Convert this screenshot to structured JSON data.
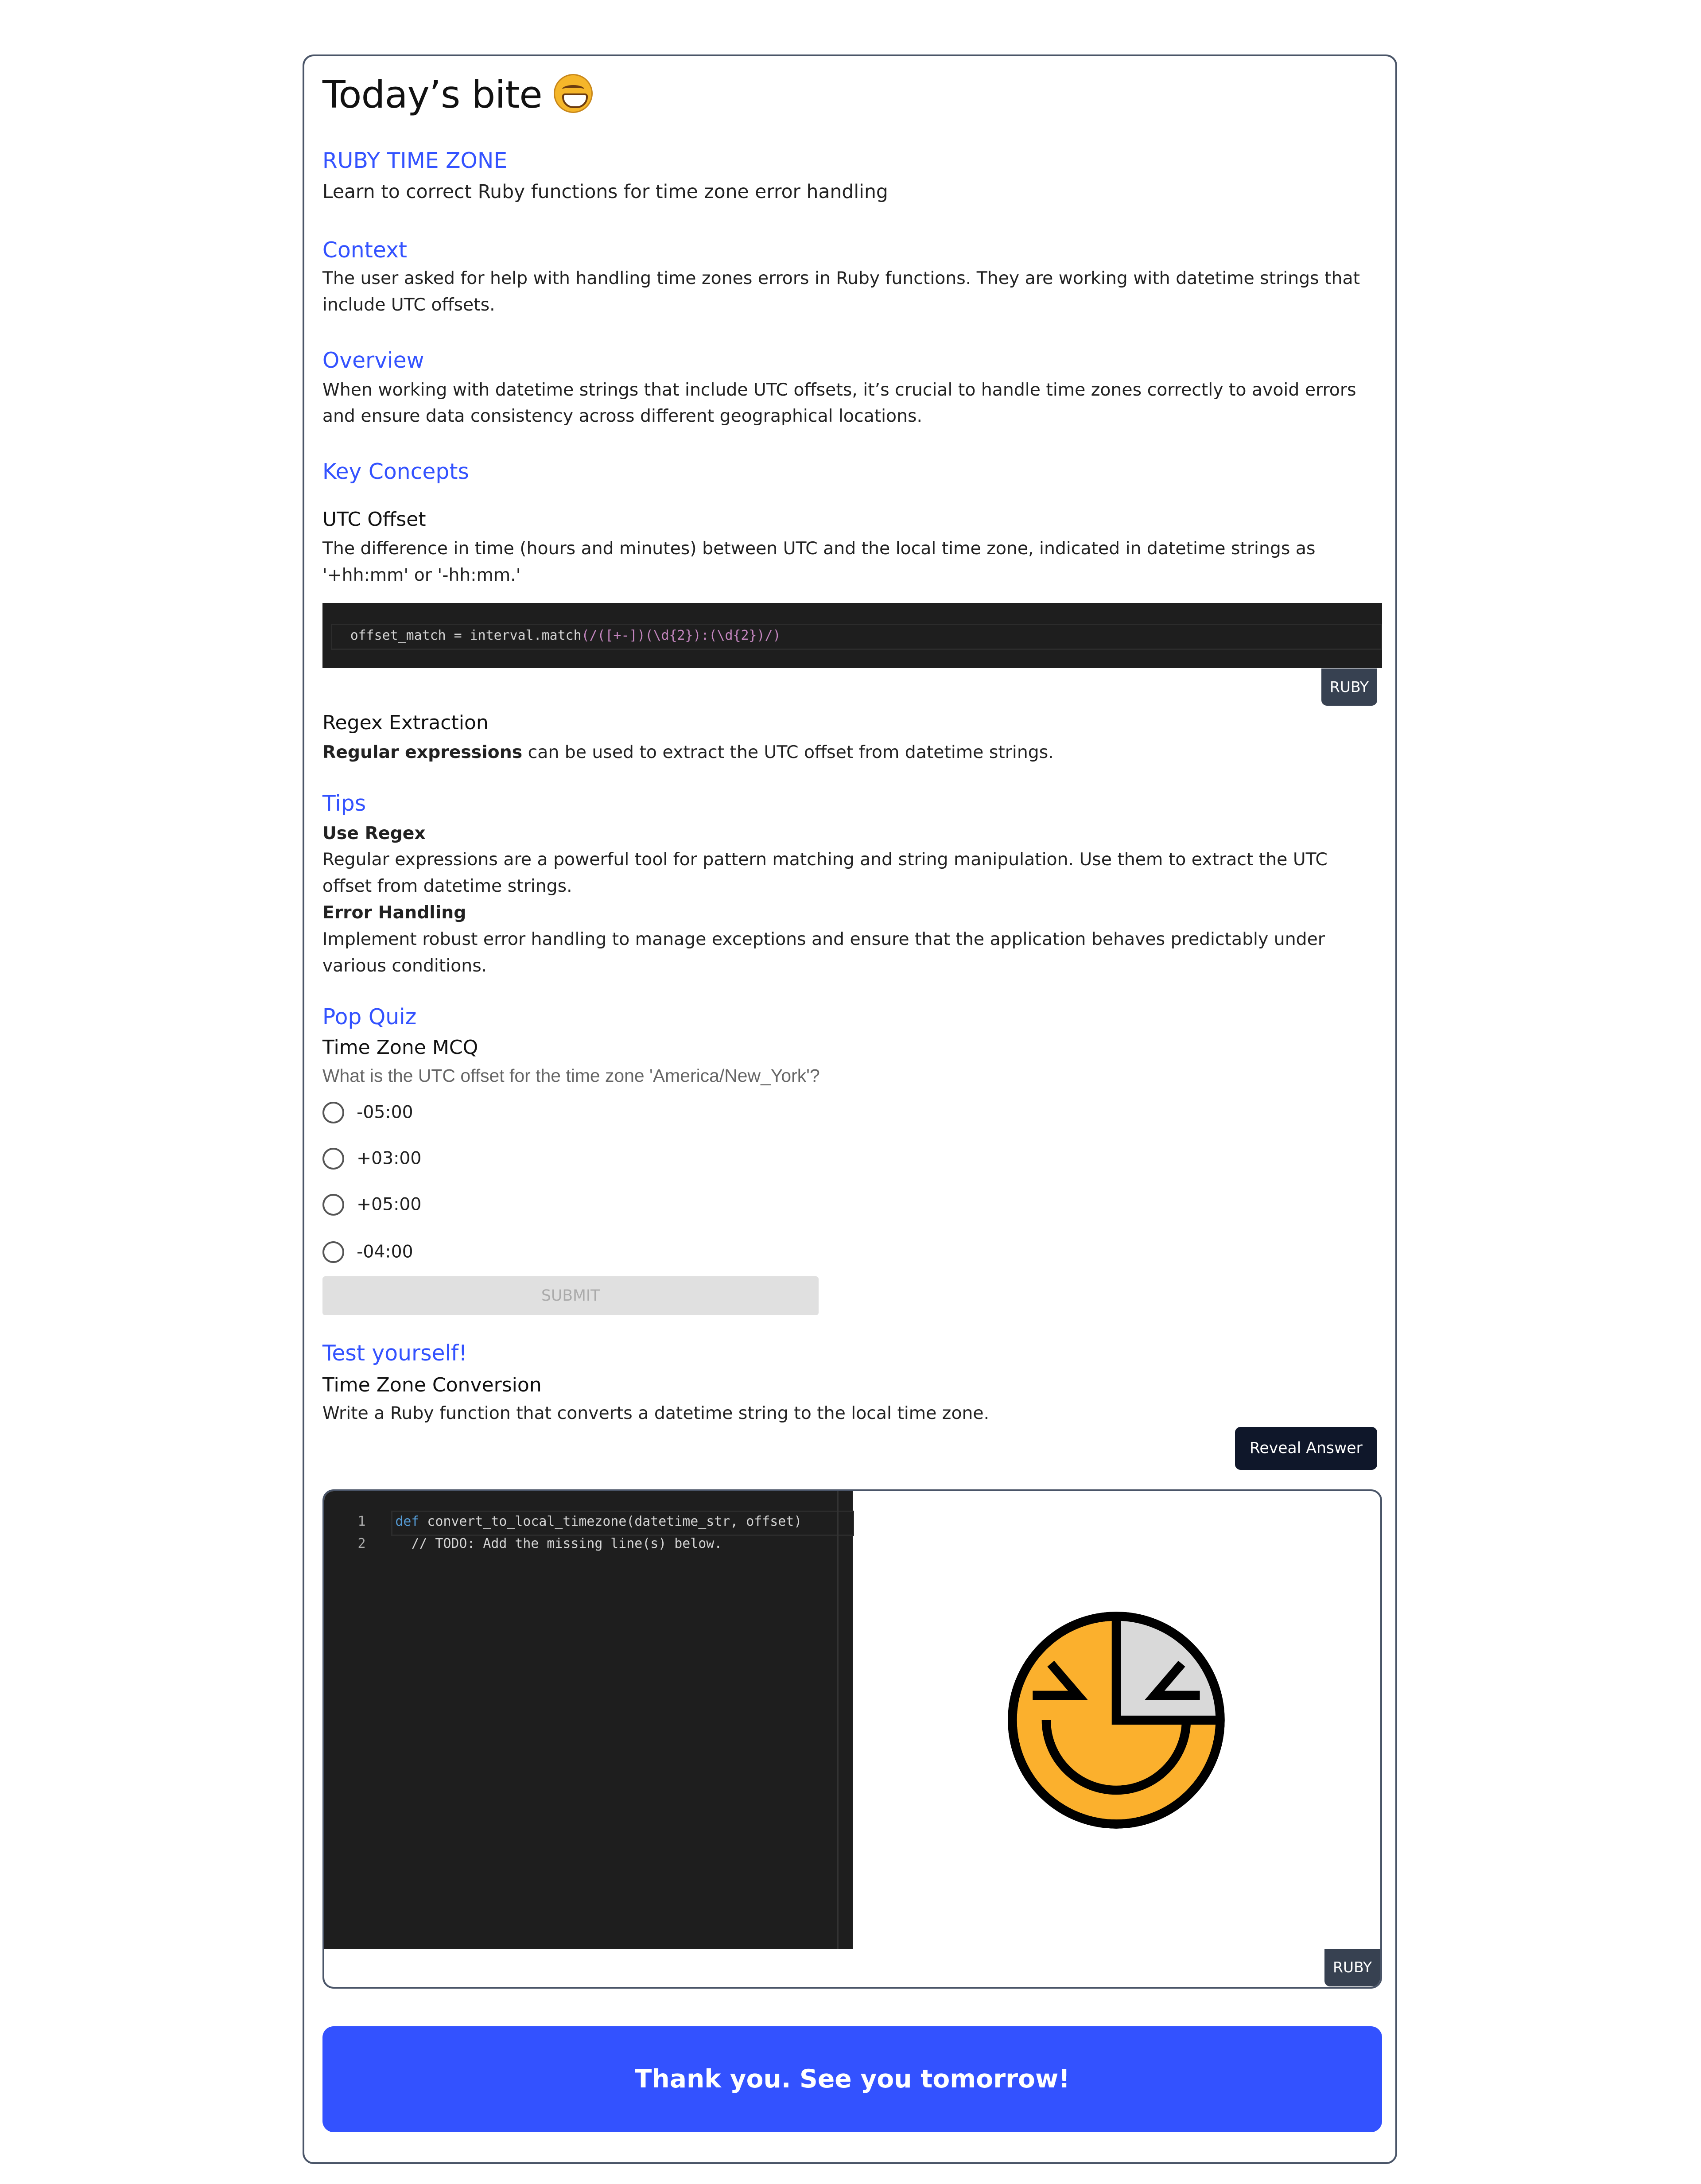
{
  "title": "Today’s bite",
  "topic": "RUBY TIME ZONE",
  "subtitle": "Learn to correct Ruby functions for time zone error handling",
  "context": {
    "heading": "Context",
    "text": "The user asked for help with handling time zones errors in Ruby functions. They are working with datetime strings that include UTC offsets."
  },
  "overview": {
    "heading": "Overview",
    "text": "When working with datetime strings that include UTC offsets, it’s crucial to handle time zones correctly to avoid errors and ensure data consistency across different geographical locations."
  },
  "key_concepts": {
    "heading": "Key Concepts",
    "c1": {
      "title": "UTC Offset",
      "text": "The difference in time (hours and minutes) between UTC and the local time zone, indicated in datetime strings as '+hh:mm' or '-hh:mm.'",
      "code_a": "offset_match = interval.match",
      "code_b": "(/([+-])(\\d{2}):(\\d{2})/)",
      "lang": "RUBY"
    },
    "c2": {
      "title": "Regex Extraction",
      "bold": "Regular expressions",
      "text": " can be used to extract the UTC offset from datetime strings."
    }
  },
  "tips": {
    "heading": "Tips",
    "t1": {
      "title": "Use Regex",
      "text": "Regular expressions are a powerful tool for pattern matching and string manipulation. Use them to extract the UTC offset from datetime strings."
    },
    "t2": {
      "title": "Error Handling",
      "text": "Implement robust error handling to manage exceptions and ensure that the application behaves predictably under various conditions."
    }
  },
  "quiz": {
    "heading": "Pop Quiz",
    "title": "Time Zone MCQ",
    "question": "What is the UTC offset for the time zone 'America/New_York'?",
    "options": [
      "-05:00",
      "+03:00",
      "+05:00",
      "-04:00"
    ],
    "submit": "SUBMIT"
  },
  "test": {
    "heading": "Test yourself!",
    "title": "Time Zone Conversion",
    "text": "Write a Ruby function that converts a datetime string to the local time zone.",
    "reveal": "Reveal Answer",
    "lines": [
      {
        "n": "1",
        "kw": "def",
        "code": " convert_to_local_timezone(datetime_str, offset)"
      },
      {
        "n": "2",
        "kw": "",
        "code": "  // TODO: Add the missing line(s) below."
      }
    ],
    "lang": "RUBY"
  },
  "cta": "Thank you. See you tomorrow!",
  "colors": {
    "accent": "#3352ff",
    "logo_orange": "#fbb02d",
    "logo_gray": "#d9d9d9"
  }
}
